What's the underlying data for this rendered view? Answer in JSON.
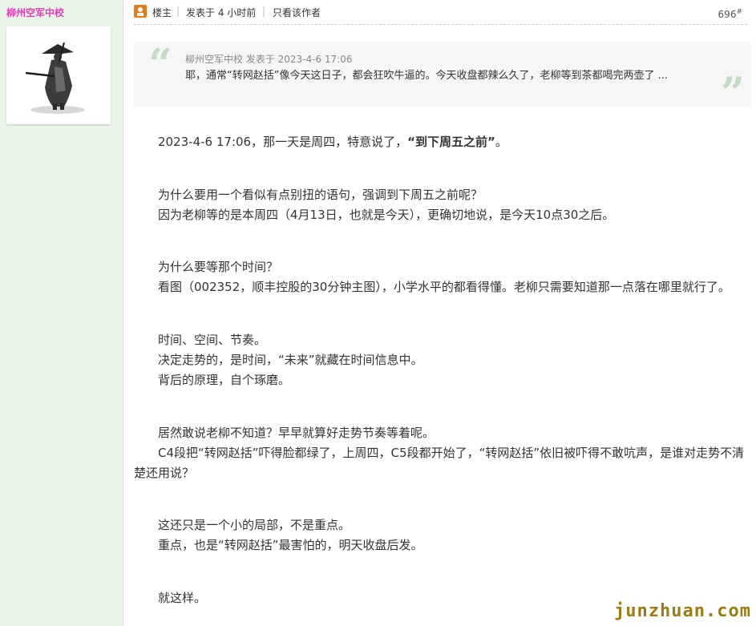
{
  "sidebar": {
    "username": "柳州空军中校",
    "avatar_icon": "samurai-avatar-icon"
  },
  "post_header": {
    "owner_icon": "floor-owner-icon",
    "owner_label": "楼主",
    "separator": "|",
    "post_time": "发表于 4 小时前",
    "author_only": "只看该作者",
    "floor_number": "696",
    "floor_suffix": "#"
  },
  "quote": {
    "meta": "柳州空军中校 发表于 2023-4-6 17:06",
    "body": "耶，通常“转网赵括”像今天这日子，都会狂吹牛逼的。今天收盘都辣么久了，老柳等到茶都喝完两壶了 ..."
  },
  "content": {
    "p1_pre": "2023-4-6 17:06，那一天是周四，特意说了，",
    "p1_bold": "“到下周五之前”",
    "p1_post": "。",
    "p2": "为什么要用一个看似有点别扭的语句，强调到下周五之前呢？",
    "p3": "因为老柳等的是本周四（4月13日，也就是今天），更确切地说，是今天10点30之后。",
    "p4": "为什么要等那个时间？",
    "p5": "看图（002352，顺丰控股的30分钟主图），小学水平的都看得懂。老柳只需要知道那一点落在哪里就行了。",
    "p6": "时间、空间、节奏。",
    "p7": "决定走势的，是时间，“未来”就藏在时间信息中。",
    "p8": "背后的原理，自个琢磨。",
    "p9": "居然敢说老柳不知道？早早就算好走势节奏等着呢。",
    "p10": "C4段把“转网赵括”吓得脸都绿了，上周四，C5段都开始了，“转网赵括”依旧被吓得不敢吭声，是谁对走势不清楚还用说？",
    "p11": "这还只是一个小的局部，不是重点。",
    "p12": "重点，也是“转网赵括”最害怕的，明天收盘后发。",
    "p13": "就这样。"
  },
  "watermark": "junzhuan.com",
  "colors": {
    "sidebar_bg": "#eaf5ea",
    "username": "#e040b0",
    "quote_bg": "#f6f6f6",
    "quote_mark": "#c4dcc4",
    "watermark": "#9a7d14"
  }
}
